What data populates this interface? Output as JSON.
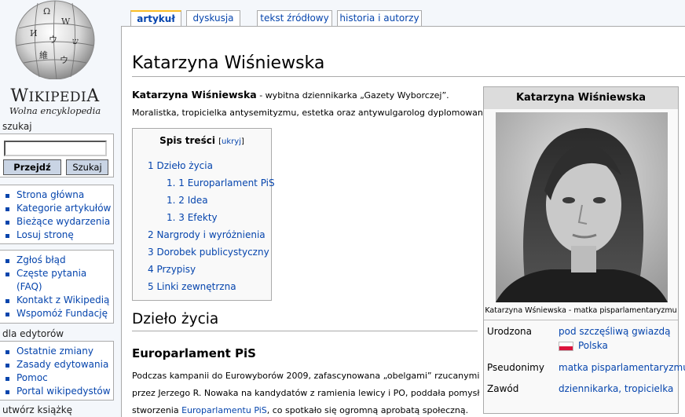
{
  "logo": {
    "wordmark_big1": "W",
    "wordmark_small": "IKIPEDI",
    "wordmark_big2": "A",
    "tagline": "Wolna encyklopedia"
  },
  "search": {
    "heading": "szukaj",
    "value": "",
    "go_label": "Przejdź",
    "search_label": "Szukaj"
  },
  "navigation": [
    "Strona główna",
    "Kategorie artykułów",
    "Bieżące wydarzenia",
    "Losuj stronę"
  ],
  "interaction": [
    "Zgłoś błąd",
    "Częste pytania",
    "(FAQ)",
    "Kontakt z Wikipedią",
    "Wspomóż Fundację"
  ],
  "editors": {
    "heading": "dla edytorów",
    "items": [
      "Ostatnie zmiany",
      "Zasady edytowania",
      "Pomoc",
      "Portal wikipedystów"
    ]
  },
  "book": {
    "heading": "utwórz książkę"
  },
  "tabs": [
    "artykuł",
    "dyskusja",
    "tekst źródłowy",
    "historia i autorzy"
  ],
  "article": {
    "title": "Katarzyna Wiśniewska",
    "lead_bold": "Katarzyna Wiśniewska",
    "lead_rest": " - wybitna dziennikarka „Gazety Wyborczej”.",
    "lead_line2": "Moralistka, tropicielka antysemityzmu, estetka oraz antywulgarolog dyplomowany.",
    "toc": {
      "title": "Spis treści",
      "hide_open": "[",
      "hide_link": "ukryj",
      "hide_close": "]",
      "items": [
        "1 Dzieło życia",
        "1. 1  Europarlament PiS",
        "1. 2  Idea",
        "1. 3  Efekty",
        "2 Nargrody i wyróżnienia",
        "3 Dorobek publicystyczny",
        "4 Przypisy",
        "5 Linki zewnętrzna"
      ]
    },
    "section_heading": "Dzieło życia",
    "subsection_heading": "Europarlament PiS",
    "body_line1": "Podczas kampanii do Eurowyborów 2009, zafascynowana „obelgami” rzucanymi",
    "body_line2": "przez Jerzego R. Nowaka na kandydatów z ramienia lewicy i PO, poddała pomysł",
    "body_line3_pre": "stworzenia ",
    "body_line3_link": "Europarlamentu PiS",
    "body_line3_post": ", co spotkało się ogromną aprobatą społeczną."
  },
  "infobox": {
    "title": "Katarzyna Wiśniewska",
    "caption": "Katarzyna Wśniewska - matka pisparlamentaryzmu",
    "rows": [
      {
        "label": "Urodzona",
        "value": "pod szczęśliwą gwiazdą",
        "value2": "Polska"
      },
      {
        "label": "Pseudonimy",
        "value": "matka pisparlamentaryzmu"
      },
      {
        "label": "Zawód",
        "value": "dziennikarka, tropicielka"
      }
    ]
  },
  "colors": {
    "link": "#0645ad",
    "tab_selected": "#fabd23",
    "background": "#f4f7fb",
    "flag_red": "#dc143c"
  }
}
